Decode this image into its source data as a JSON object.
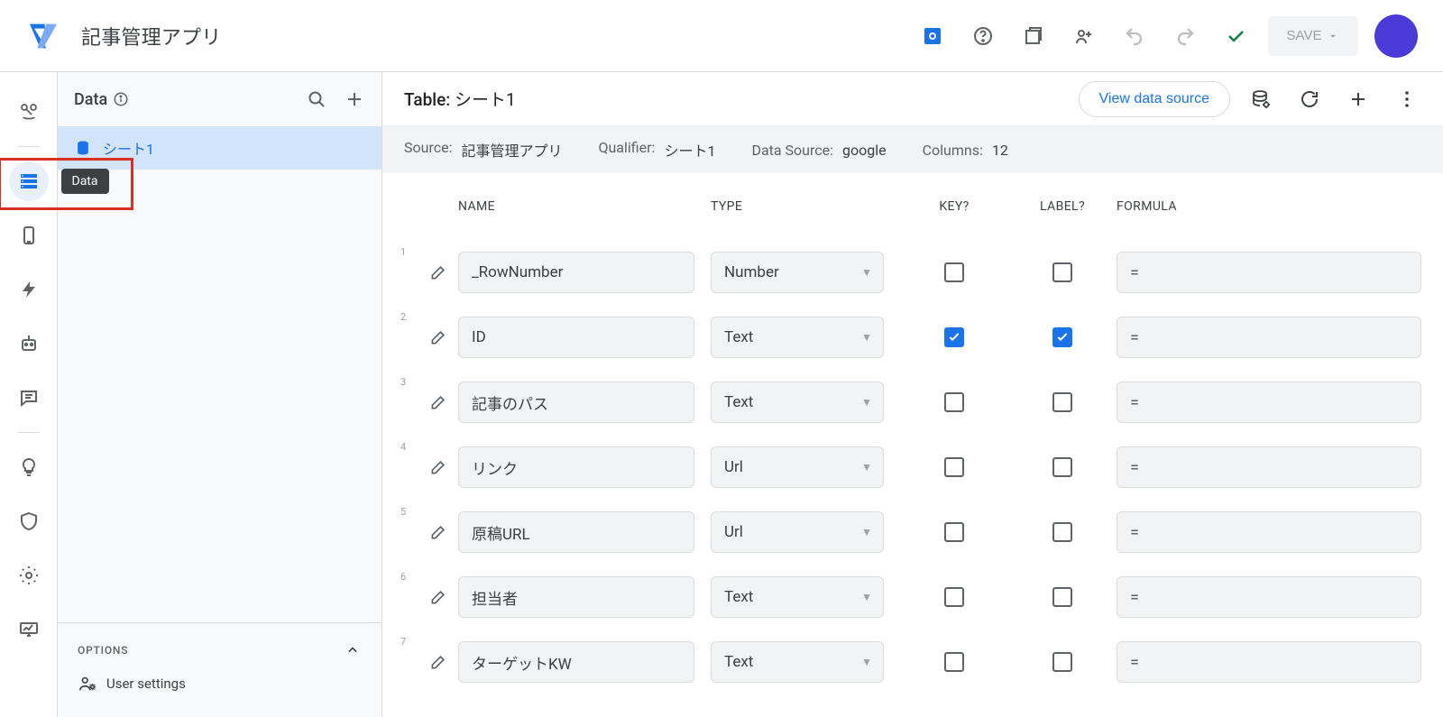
{
  "topbar": {
    "app_title": "記事管理アプリ",
    "save_label": "SAVE"
  },
  "rail": {
    "active_tooltip": "Data"
  },
  "panel_data": {
    "title": "Data",
    "items": [
      {
        "name": "シート1"
      }
    ],
    "options_label": "OPTIONS",
    "user_settings_label": "User settings"
  },
  "main": {
    "table_label": "Table:",
    "table_name": "シート1",
    "view_data_source": "View data source",
    "info": {
      "source_label": "Source:",
      "source_value": "記事管理アプリ",
      "qualifier_label": "Qualifier:",
      "qualifier_value": "シート1",
      "ds_label": "Data Source:",
      "ds_value": "google",
      "cols_label": "Columns:",
      "cols_value": "12"
    },
    "columns_header": {
      "name": "NAME",
      "type": "TYPE",
      "key": "KEY?",
      "label": "LABEL?",
      "formula": "FORMULA"
    },
    "rows": [
      {
        "n": "1",
        "name": "_RowNumber",
        "type": "Number",
        "key": false,
        "label": false,
        "formula": "="
      },
      {
        "n": "2",
        "name": "ID",
        "type": "Text",
        "key": true,
        "label": true,
        "formula": "="
      },
      {
        "n": "3",
        "name": "記事のパス",
        "type": "Text",
        "key": false,
        "label": false,
        "formula": "="
      },
      {
        "n": "4",
        "name": "リンク",
        "type": "Url",
        "key": false,
        "label": false,
        "formula": "="
      },
      {
        "n": "5",
        "name": "原稿URL",
        "type": "Url",
        "key": false,
        "label": false,
        "formula": "="
      },
      {
        "n": "6",
        "name": "担当者",
        "type": "Text",
        "key": false,
        "label": false,
        "formula": "="
      },
      {
        "n": "7",
        "name": "ターゲットKW",
        "type": "Text",
        "key": false,
        "label": false,
        "formula": "="
      }
    ]
  }
}
